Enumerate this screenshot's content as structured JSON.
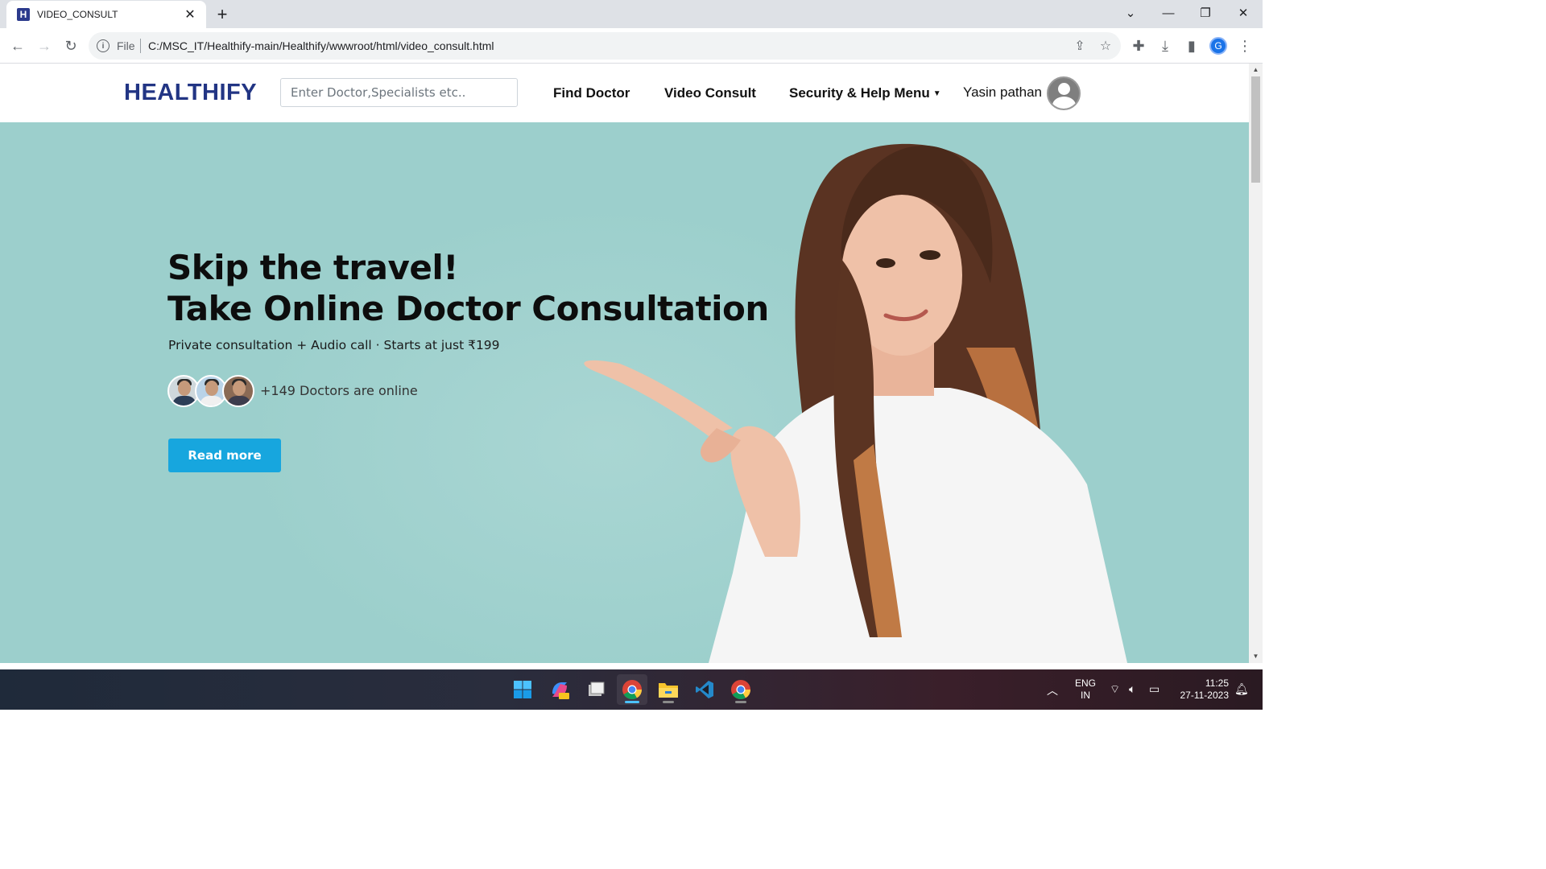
{
  "browser": {
    "tab_title": "VIDEO_CONSULT",
    "tab_favicon": "H",
    "scheme_label": "File",
    "url": "C:/MSC_IT/Healthify-main/Healthify/wwwroot/html/video_consult.html",
    "profile_initial": "G"
  },
  "navbar": {
    "logo": "HEALTHIFY",
    "search_placeholder": "Enter Doctor,Specialists etc..",
    "links": [
      "Find Doctor",
      "Video Consult",
      "Security & Help Menu"
    ],
    "user_name": "Yasin pathan"
  },
  "hero": {
    "headline_line1": "Skip the travel!",
    "headline_line2": "Take Online Doctor Consultation",
    "subtitle": "Private consultation + Audio call · Starts at just ₹199",
    "online_text": "+149 Doctors are online",
    "cta_label": "Read more",
    "background_color": "#9ccfcc",
    "cta_color": "#17a6de"
  },
  "taskbar": {
    "apps": [
      "windows-start",
      "copilot-pre",
      "file-manager",
      "chrome",
      "file-explorer",
      "vscode",
      "chrome-alt"
    ],
    "language_line1": "ENG",
    "language_line2": "IN",
    "time": "11:25",
    "date": "27-11-2023"
  }
}
